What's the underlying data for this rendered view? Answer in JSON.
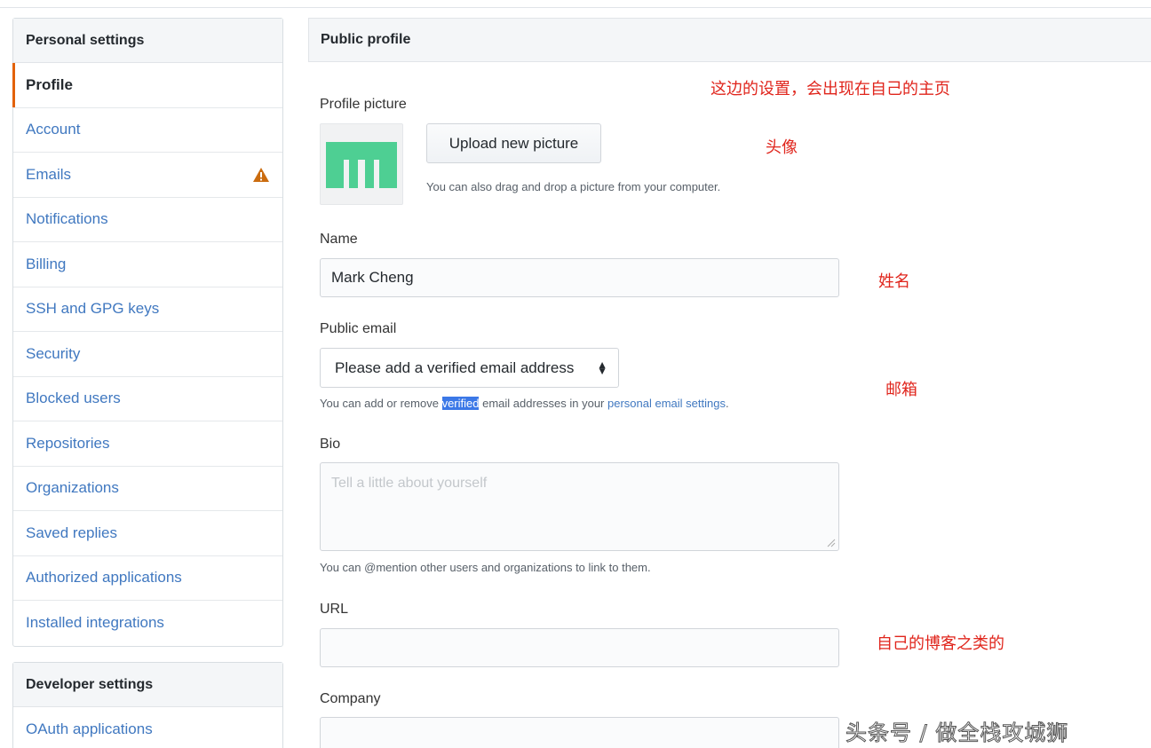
{
  "sidebar": {
    "personal_heading": "Personal settings",
    "items": [
      {
        "label": "Profile"
      },
      {
        "label": "Account"
      },
      {
        "label": "Emails"
      },
      {
        "label": "Notifications"
      },
      {
        "label": "Billing"
      },
      {
        "label": "SSH and GPG keys"
      },
      {
        "label": "Security"
      },
      {
        "label": "Blocked users"
      },
      {
        "label": "Repositories"
      },
      {
        "label": "Organizations"
      },
      {
        "label": "Saved replies"
      },
      {
        "label": "Authorized applications"
      },
      {
        "label": "Installed integrations"
      }
    ],
    "selected_index": 0,
    "warning_icon": "warning-icon",
    "developer_heading": "Developer settings",
    "developer_items": [
      {
        "label": "OAuth applications"
      }
    ]
  },
  "main": {
    "title": "Public profile",
    "picture": {
      "label": "Profile picture",
      "upload_button": "Upload new picture",
      "hint": "You can also drag and drop a picture from your computer."
    },
    "name": {
      "label": "Name",
      "value": "Mark Cheng"
    },
    "email": {
      "label": "Public email",
      "selected": "Please add a verified email address",
      "hint_before": "You can add or remove ",
      "hint_highlight": "verified",
      "hint_middle": " email addresses in your ",
      "hint_link": "personal email settings",
      "hint_after": "."
    },
    "bio": {
      "label": "Bio",
      "placeholder": "Tell a little about yourself",
      "hint": "You can @mention other users and organizations to link to them."
    },
    "url": {
      "label": "URL",
      "value": ""
    },
    "company": {
      "label": "Company",
      "value": ""
    }
  },
  "annotations": {
    "settings_note": "这边的设置，会出现在自己的主页",
    "avatar_note": "头像",
    "name_note": "姓名",
    "email_note": "邮箱",
    "url_note": "自己的博客之类的"
  },
  "watermark": "头条号 / 做全栈攻城狮",
  "colors": {
    "link": "#4078c0",
    "selected_bar": "#e36209",
    "warning": "#cb6c0f",
    "annotation": "#e0251c",
    "avatar_green": "#4ecf93",
    "highlight": "#3b78e7"
  }
}
